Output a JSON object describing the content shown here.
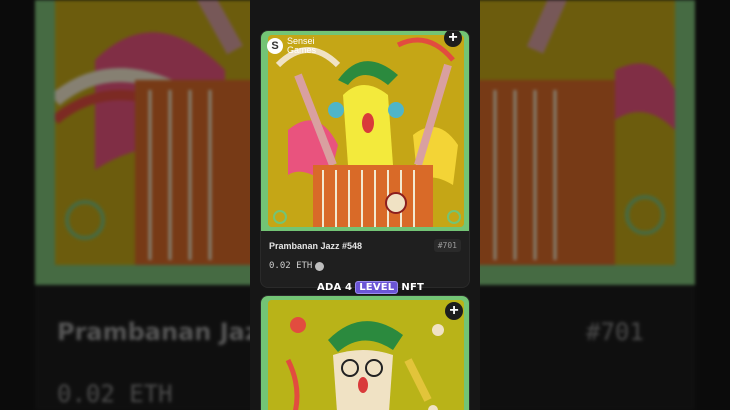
{
  "background": {
    "title": "Prambanan Jazz",
    "id": "#701",
    "price": "0.02 ETH"
  },
  "card1": {
    "brand": "Sensei Games",
    "title": "Prambanan Jazz #548",
    "id": "#701",
    "price": "0.02 ETH",
    "add_label": "+"
  },
  "card2": {
    "add_label": "+"
  },
  "caption": {
    "part1": "ADA 4",
    "part2": "LEVEL",
    "part3": "NFT"
  }
}
